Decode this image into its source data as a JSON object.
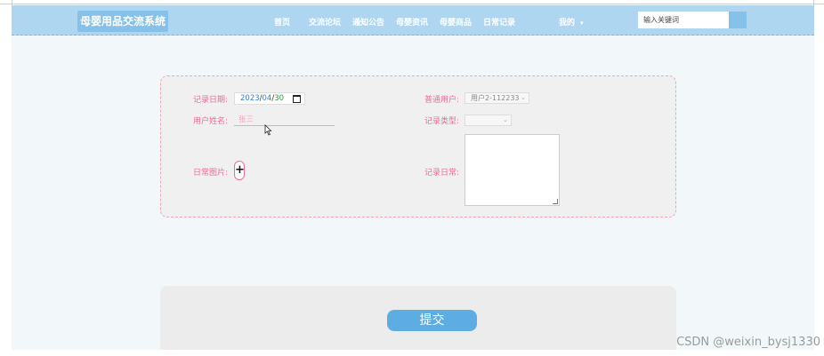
{
  "header": {
    "logo": "母婴用品交流系统",
    "nav": [
      "首页",
      "交流论坛",
      "通知公告",
      "母婴资讯",
      "母婴商品",
      "日常记录"
    ],
    "user_menu": "我的",
    "search_placeholder": "输入关键词"
  },
  "form": {
    "record_date_label": "记录日期:",
    "record_date": {
      "year": "2023",
      "month": "04",
      "day": "30"
    },
    "user_name_label": "用户姓名:",
    "user_name_value": "张三",
    "photo_label": "日常图片:",
    "add_photo": "+",
    "normal_user_label": "普通用户:",
    "normal_user_value": "用户2-112233",
    "record_type_label": "记录类型:",
    "record_type_value": "",
    "daily_record_label": "记录日常:"
  },
  "submit_label": "提交",
  "watermark": "CSDN @weixin_bysj1330",
  "colors": {
    "nav_bg": "#aed6f1",
    "accent_blue": "#5dade2",
    "label_pink": "#f06b95",
    "card_border": "#f5a3bd"
  }
}
